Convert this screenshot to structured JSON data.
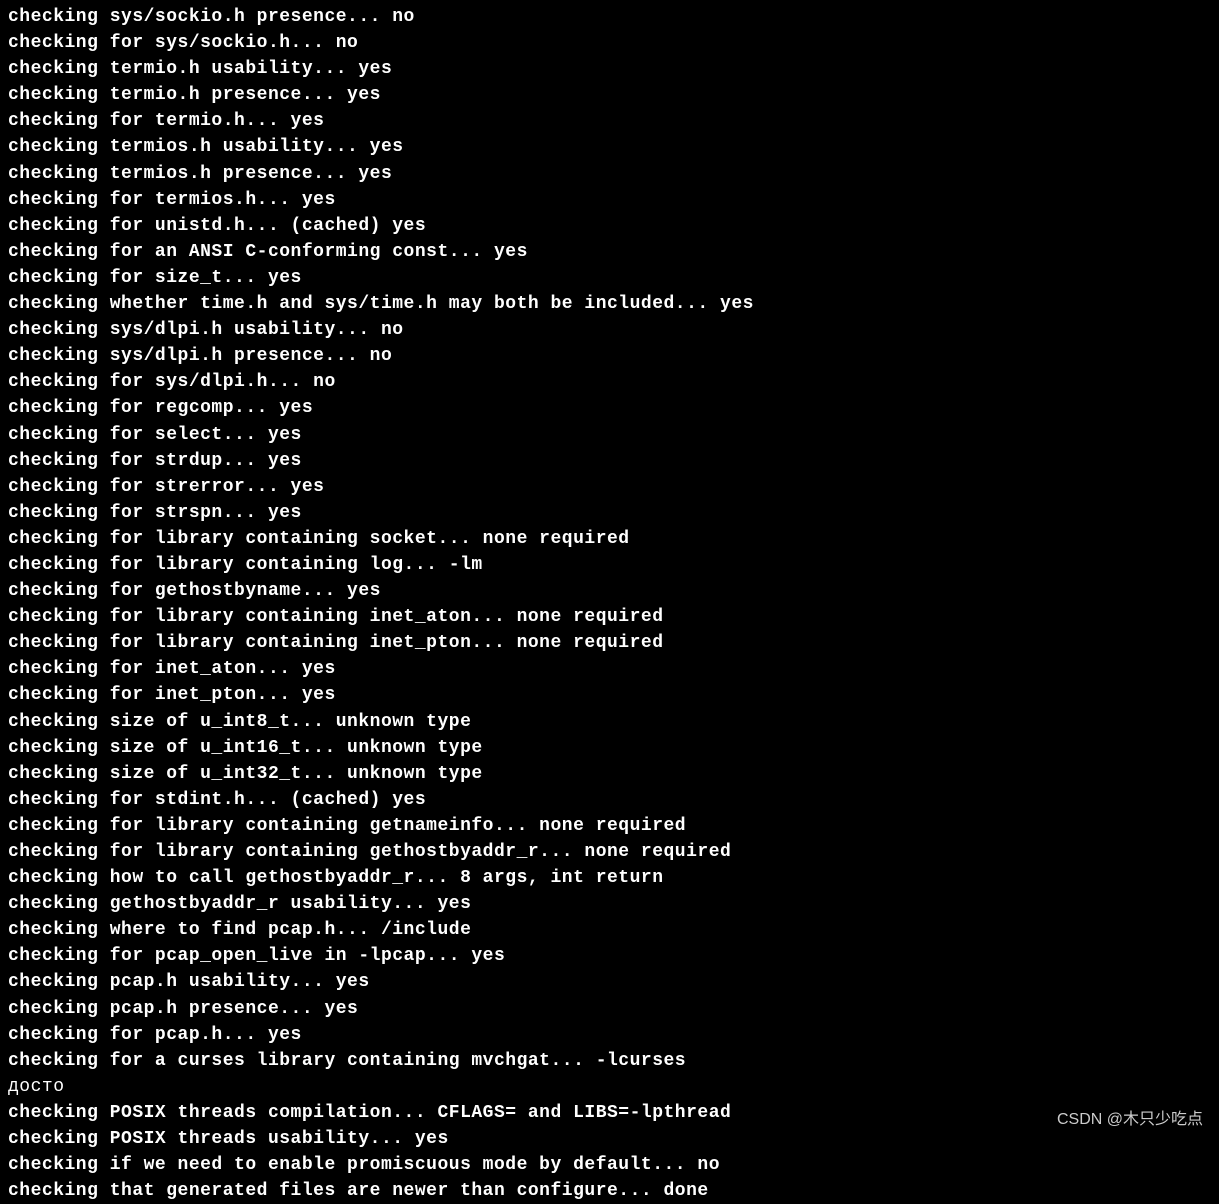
{
  "terminal": {
    "lines": [
      "checking sys/sockio.h presence... no",
      "checking for sys/sockio.h... no",
      "checking termio.h usability... yes",
      "checking termio.h presence... yes",
      "checking for termio.h... yes",
      "checking termios.h usability... yes",
      "checking termios.h presence... yes",
      "checking for termios.h... yes",
      "checking for unistd.h... (cached) yes",
      "checking for an ANSI C-conforming const... yes",
      "checking for size_t... yes",
      "checking whether time.h and sys/time.h may both be included... yes",
      "checking sys/dlpi.h usability... no",
      "checking sys/dlpi.h presence... no",
      "checking for sys/dlpi.h... no",
      "checking for regcomp... yes",
      "checking for select... yes",
      "checking for strdup... yes",
      "checking for strerror... yes",
      "checking for strspn... yes",
      "checking for library containing socket... none required",
      "checking for library containing log... -lm",
      "checking for gethostbyname... yes",
      "checking for library containing inet_aton... none required",
      "checking for library containing inet_pton... none required",
      "checking for inet_aton... yes",
      "checking for inet_pton... yes",
      "checking size of u_int8_t... unknown type",
      "checking size of u_int16_t... unknown type",
      "checking size of u_int32_t... unknown type",
      "checking for stdint.h... (cached) yes",
      "checking for library containing getnameinfo... none required",
      "checking for library containing gethostbyaddr_r... none required",
      "checking how to call gethostbyaddr_r... 8 args, int return",
      "checking gethostbyaddr_r usability... yes",
      "checking where to find pcap.h... /include",
      "checking for pcap_open_live in -lpcap... yes",
      "checking pcap.h usability... yes",
      "checking pcap.h presence... yes",
      "checking for pcap.h... yes",
      "checking for a curses library containing mvchgat... -lcurses",
      "checking POSIX threads compilation... CFLAGS= and LIBS=-lpthread",
      "checking POSIX threads usability... yes",
      "checking if we need to enable promiscuous mode by default... no",
      "checking that generated files are newer than configure... done"
    ]
  },
  "watermark": {
    "text": "CSDN @木只少吃点"
  }
}
